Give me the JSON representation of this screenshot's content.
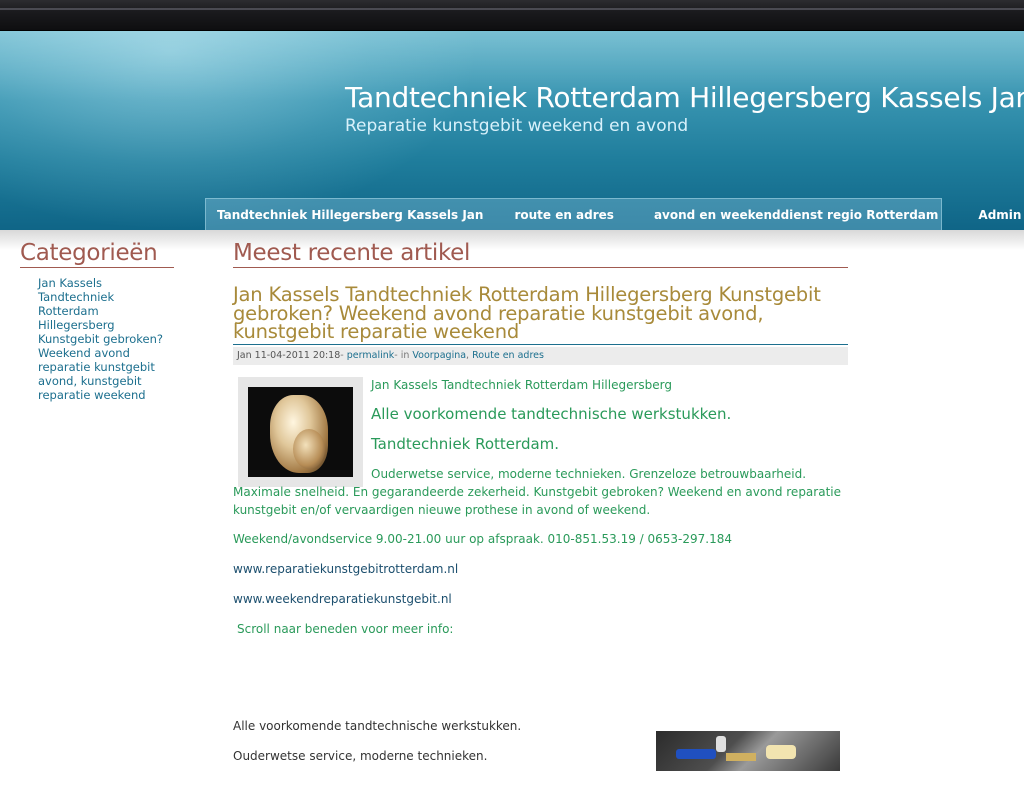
{
  "site": {
    "title": "Tandtechniek Rotterdam Hillegersberg Kassels Jan",
    "subtitle": "Reparatie kunstgebit weekend en avond"
  },
  "nav": {
    "items": [
      {
        "label": "Tandtechniek Hillegersberg Kassels Jan"
      },
      {
        "label": "route en adres"
      },
      {
        "label": "avond en weekenddienst regio Rotterdam"
      },
      {
        "label": "Admin"
      }
    ]
  },
  "sidebar": {
    "heading": "Categorieën",
    "items": [
      {
        "label": "Jan Kassels Tandtechniek Rotterdam Hillegersberg Kunstgebit gebroken? Weekend avond reparatie kunstgebit avond, kunstgebit reparatie weekend"
      }
    ]
  },
  "main": {
    "heading": "Meest recente artikel",
    "post": {
      "title": "Jan Kassels Tandtechniek Rotterdam Hillegersberg Kunstgebit gebroken? Weekend avond reparatie kunstgebit avond, kunstgebit reparatie weekend",
      "meta": {
        "date": "Jan 11-04-2011 20:18",
        "sep1": "-",
        "permalink": "permalink",
        "sep2": "- in",
        "cat1": "Voorpagina",
        "comma": ",",
        "cat2": "Route en adres"
      },
      "lines": {
        "intro": "Jan Kassels Tandtechniek Rotterdam Hillegersberg",
        "h1": "Alle voorkomende tandtechnische werkstukken.",
        "h2": "Tandtechniek Rotterdam.",
        "para1": "Ouderwetse service, moderne technieken. Grenzeloze betrouwbaarheid. Maximale snelheid. En gegarandeerde zekerheid. Kunstgebit gebroken? Weekend en avond reparatie kunstgebit en/of vervaardigen nieuwe prothese in avond of weekend.",
        "phone": "Weekend/avondservice 9.00-21.00 uur op afspraak. 010-851.53.19  /  0653-297.184",
        "link1": "www.reparatiekunstgebitrotterdam.nl",
        "link2": "www.weekendreparatiekunstgebit.nl",
        "scroll": "Scroll naar beneden voor meer info:",
        "para2": "Alle voorkomende tandtechnische werkstukken.",
        "para3": "Ouderwetse service, moderne technieken."
      }
    }
  },
  "colors": {
    "heading": "#a05a50",
    "post_title": "#a88a3a",
    "body_text": "#2a9a5a",
    "link": "#1c6f8e",
    "header_blue": "#1f7d9c"
  }
}
